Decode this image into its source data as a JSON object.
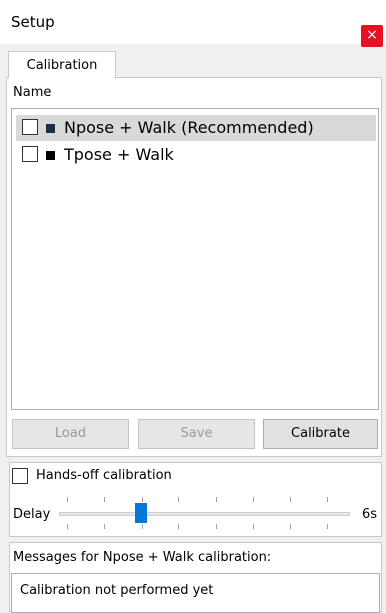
{
  "window": {
    "title": "Setup",
    "close_glyph": "×"
  },
  "tabs": [
    {
      "label": "Calibration",
      "selected": true
    }
  ],
  "list": {
    "header": "Name",
    "items": [
      {
        "label": "Npose + Walk (Recommended)",
        "checked": false,
        "selected": true,
        "color": "#1a2e44"
      },
      {
        "label": "Tpose + Walk",
        "checked": false,
        "selected": false,
        "color": "#000000"
      }
    ]
  },
  "buttons": {
    "load": "Load",
    "save": "Save",
    "calibrate": "Calibrate"
  },
  "handsoff": {
    "label": "Hands-off calibration",
    "checked": false
  },
  "delay": {
    "label": "Delay",
    "value_label": "6s",
    "min": 0,
    "max": 6,
    "value": 1.7
  },
  "messages": {
    "header": "Messages for Npose + Walk calibration:",
    "text": "Calibration not performed yet"
  }
}
